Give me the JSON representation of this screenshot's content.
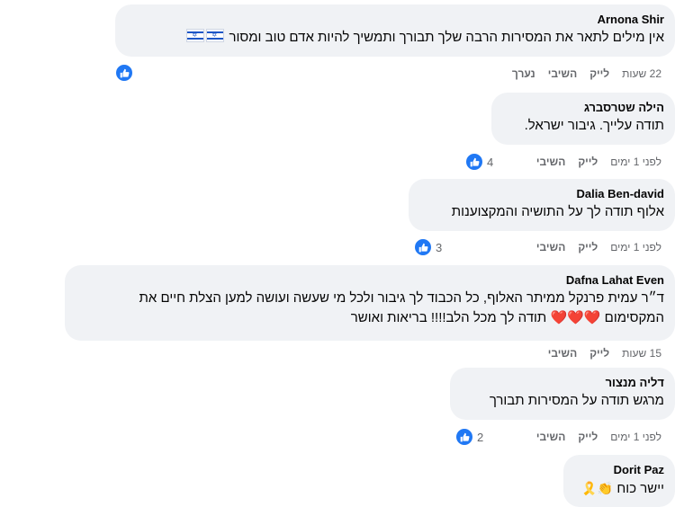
{
  "comments": [
    {
      "author": "Arnona Shir",
      "text": "אין מילים לתאר את המסירות הרבה שלך תבורך ותמשיך להיות אדם טוב ומסור",
      "emoji": "🇮🇱 🇮🇱",
      "time": "22 שעות",
      "like_label": "לייק",
      "reply_label": "השיבי",
      "edited_label": "נערך",
      "reactions": ""
    },
    {
      "author": "הילה שטרסברג",
      "text": "תודה עלייך. גיבור ישראל.",
      "time": "לפני 1 ימים",
      "like_label": "לייק",
      "reply_label": "השיבי",
      "reactions": "4"
    },
    {
      "author": "Dalia Ben-david",
      "text": "אלוף תודה לך על התושיה והמקצוענות",
      "time": "לפני 1 ימים",
      "like_label": "לייק",
      "reply_label": "השיבי",
      "reactions": "3"
    },
    {
      "author": "Dafna Lahat Even",
      "text_line1": "ד״ר עמית פרנקל ממיתר האלוף, כל הכבוד לך גיבור ולכל מי שעשה ועושה למען הצלת חיים את",
      "text_line2_a": "המקסימום",
      "text_line2_hearts": "❤️❤️❤️",
      "text_line2_b": "תודה לך מכל הלב!!!! בריאות ואושר",
      "time": "15 שעות",
      "like_label": "לייק",
      "reply_label": "השיבי"
    },
    {
      "author": "דליה מנצור",
      "text": "מרגש תודה על המסירות תבורך",
      "time": "לפני 1 ימים",
      "like_label": "לייק",
      "reply_label": "השיבי",
      "reactions": "2"
    },
    {
      "author": "Dorit Paz",
      "text": "יישר כוח",
      "emoji": "👏🎗️"
    }
  ],
  "colors": {
    "like_blue": "#2078f4",
    "bubble": "#f0f2f5",
    "meta": "#65676b"
  },
  "icons": {
    "like": "thumbs-up-icon",
    "flag": "israel-flag-icon"
  }
}
